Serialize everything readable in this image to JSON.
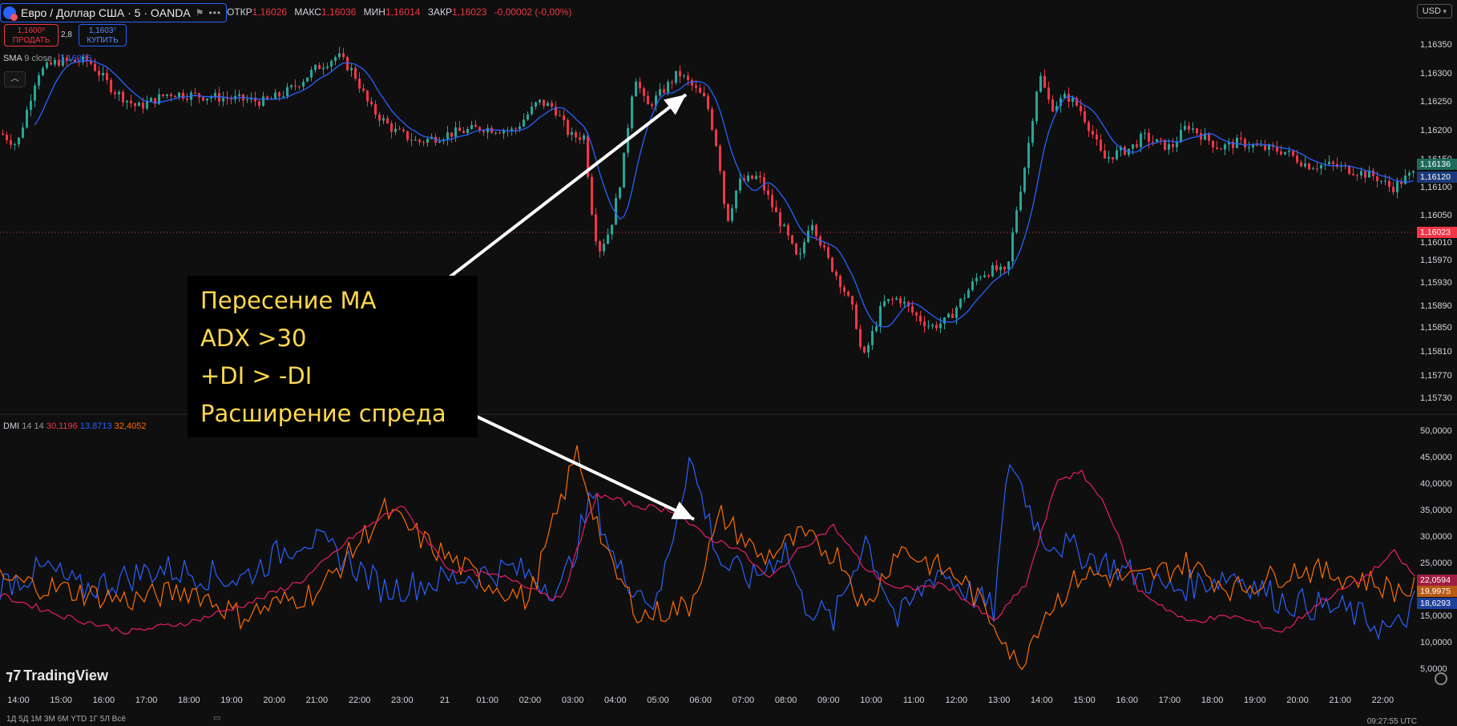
{
  "header": {
    "symbol_title": "Евро / Доллар США · 5 · OANDA",
    "ohlc": [
      {
        "label": "ОТКР",
        "value": "1,16026"
      },
      {
        "label": "МАКС",
        "value": "1,16036"
      },
      {
        "label": "МИН",
        "value": "1,16014"
      },
      {
        "label": "ЗАКР",
        "value": "1,16023"
      },
      {
        "label": "",
        "value": "-0,00002 (-0,00%)"
      }
    ],
    "currency": "USD"
  },
  "trade": {
    "sell_price": "1,1600⁹",
    "sell_label": "ПРОДАТЬ",
    "spread": "2,8",
    "buy_price": "1,1603⁷",
    "buy_label": "КУПИТЬ"
  },
  "sma_legend": {
    "name": "SMA",
    "params": "9 close",
    "value": "1,16026"
  },
  "dmi_legend": {
    "name": "DMI",
    "params": "14 14",
    "plus_di": "30,1196",
    "minus_di": "13,8713",
    "adx": "32,4052"
  },
  "price_axis": [
    "1,16350",
    "1,16300",
    "1,16250",
    "1,16200",
    "1,16150",
    "1,16100",
    "1,16050",
    "1,16010",
    "1,15970",
    "1,15930",
    "1,15890",
    "1,15850",
    "1,15810",
    "1,15770",
    "1,15730"
  ],
  "price_tags": [
    {
      "value": "1,16136",
      "color": "#1e6b5a"
    },
    {
      "value": "1,16120",
      "color": "#1c3a7a"
    },
    {
      "value": "1,16023",
      "color": "#f23645"
    }
  ],
  "dmi_axis": [
    "50,0000",
    "45,0000",
    "40,0000",
    "35,0000",
    "30,0000",
    "25,0000",
    "20,0000",
    "15,0000",
    "10,0000",
    "5,0000"
  ],
  "dmi_tags": [
    {
      "value": "22,0594",
      "color": "#a01e40"
    },
    {
      "value": "19,9975",
      "color": "#b85a14"
    },
    {
      "value": "18,6293",
      "color": "#1e3f9a"
    }
  ],
  "time_axis": [
    "14:00",
    "15:00",
    "16:00",
    "17:00",
    "18:00",
    "19:00",
    "20:00",
    "21:00",
    "22:00",
    "23:00",
    "21",
    "01:00",
    "02:00",
    "03:00",
    "04:00",
    "05:00",
    "06:00",
    "07:00",
    "08:00",
    "09:00",
    "10:00",
    "11:00",
    "12:00",
    "13:00",
    "14:00",
    "15:00",
    "16:00",
    "17:00",
    "18:00",
    "19:00",
    "20:00",
    "21:00",
    "22:00"
  ],
  "annotation": [
    "Пересение MA",
    "ADX >30",
    "+DI > -DI",
    "Расширение спреда"
  ],
  "watermark": "TradingView",
  "bottom_bar": "1Д  5Д  1М  3М  6М  YTD  1Г  5Л  Всё",
  "clock": "09:27:55 UTC",
  "colors": {
    "bull": "#26a69a",
    "bear": "#f23645",
    "sma": "#2962ff",
    "plus_di": "#2962ff",
    "minus_di": "#ff6d00",
    "adx": "#e91e63"
  }
}
